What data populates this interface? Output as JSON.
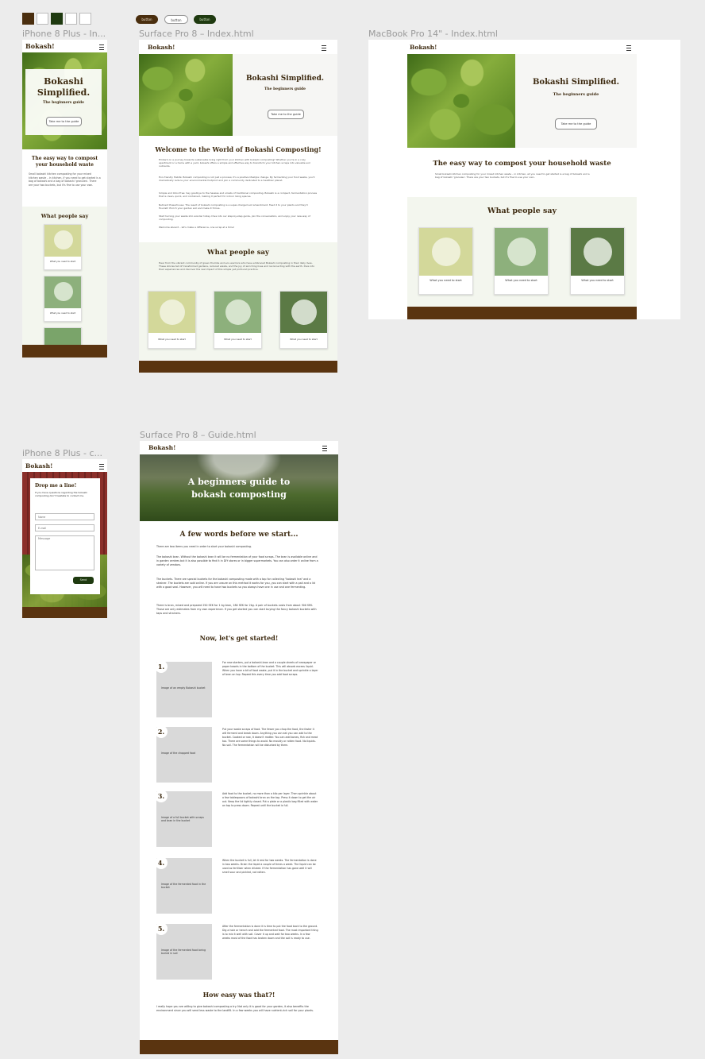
{
  "palette": {
    "colors": [
      "#4a2e0e",
      "#ffffff",
      "#1f3a10",
      "#ffffff",
      "#ffffff"
    ],
    "buttons": [
      "button",
      "button",
      "button"
    ]
  },
  "frames": {
    "iphone_index": {
      "label": "iPhone 8 Plus - In...",
      "brand": "Bokash!",
      "hero_title": "Bokashi Simplified.",
      "hero_sub": "The beginners guide",
      "hero_btn": "Take me to the guide",
      "intro_title": "The easy way to compost your household waste",
      "intro_text": "Small bokashi kitchen composting for your mixed kitchen waste – in kitchen, if you need to get started is a bag of bokashi and a bag of bokashi 'granules'. There are your two buckets, but it's fine to use your own.",
      "testimonials_title": "What people say",
      "card_caption": "What you need to start"
    },
    "surface_index": {
      "label": "Surface Pro 8 – Index.html",
      "brand": "Bokash!",
      "hero_title": "Bokashi Simplified.",
      "hero_sub": "The beginners guide",
      "hero_btn": "Take me to the guide",
      "welcome_title": "Welcome to the World of Bokashi Composting!",
      "paragraphs": [
        "Embark on a journey towards sustainable living right from your kitchen with bokashi composting! Whether you're in a cozy apartment or a home with a yard, bokashi offers a simple and effective way to transform your kitchen scraps into valuable soil nutrients.",
        "Eco-friendly Habits: Bokashi composting is not just a process; it's a positive lifestyle change. By fermenting your food waste, you'll dramatically reduce your environmental footprint and join a community dedicated to a healthier planet.",
        "Simple and Odor-Free: Say goodbye to the hassles and smells of traditional composting. Bokashi is a compact, fermentation process that is clean, quick, and contained, making it perfect for indoor living spaces.",
        "Nutrient Powerhouse: The result of bokashi composting is a super-charged soil amendment. Feed it to your plants and they'll flourish! Enrich your garden soil and make it thrive.",
        "Start turning your waste into wonder today. Dive into our step-by-step guide, join the conversation, and enjoy your new way of composting.",
        "Welcome aboard – let's make a difference, one scrap at a time!"
      ],
      "testimonials_title": "What people say",
      "testimonials_intro": "Hear from the vibrant community of green thumbs and eco-warriors who have embraced Bokashi composting in their daily lives. These stories tell of transformed gardens, reduced waste, and the joy of enriching lives and reconnecting with the earth. Dive into their experiences and discover the real impact of this simple yet profound practice.",
      "card_caption": "What you need to start"
    },
    "macbook_index": {
      "label": "MacBook Pro 14\" - Index.html",
      "brand": "Bokash!",
      "hero_title": "Bokashi Simplified.",
      "hero_sub": "The beginners guide",
      "hero_btn": "Take me to the guide",
      "intro_title": "The easy way to compost your household waste",
      "intro_text": "Small bokashi kitchen composting for your mixed kitchen waste – in kitchen, all you need to get started is a bag of bokashi and a bag of bokashi 'granules'. There are your two buckets, but it's fine to use your own.",
      "testimonials_title": "What people say",
      "card_caption": "What you need to start"
    },
    "iphone_contact": {
      "label": "iPhone 8 Plus - c...",
      "brand": "Bokash!",
      "title": "Drop me a line!",
      "text": "If you have questions regarding the bokashi composting don't hesitate to contact me.",
      "name_placeholder": "Name",
      "email_placeholder": "E-mail",
      "message_placeholder": "Message",
      "send": "Send"
    },
    "surface_guide": {
      "label": "Surface Pro 8 – Guide.html",
      "brand": "Bokash!",
      "hero_title": "A beginners guide to bokash composting",
      "before_title": "A few words before we start...",
      "before_paragraphs": [
        "There are two items you need in order to start your bokashi composting.",
        "The bokashi bran. Without the bokashi bran it will be no fermentation of your food scraps. The bran is available online and in garden centres but it is also possible to find it in DIY stores or in bigger supermarkets. You can also order it online from a variety of vendors.",
        "The buckets. There are special buckets for the bokashi composting made with a tap for collecting \"bokashi tea\" and a strainer. The buckets are sold online. If you are unsure on this method it works for you, you can start with a pail and a lid with a good seal. However, you will need to have two buckets so you always have one in use and one fermenting.",
        "There is bran, mixed and prepared 250 SEK for 1 kg bran, 180 SEK for 2kg. A pair of buckets costs from about 300 SEK. Those are only estimates from my own experience. If you get started you can start buying the fancy bokashi buckets with taps and strainers."
      ],
      "start_title": "Now, let's get started!",
      "steps": [
        {
          "num": "1.",
          "img": "Image of an empty Bokashi bucket",
          "text": "For new starters, put a bokashi-bran and a couple sheets of newspaper or paper towels in the bottom of the bucket. This will absorb excess liquid. When you have a bit of food waste, put it in the bucket and sprinkle a layer of bran on top. Repeat this every time you add food scraps."
        },
        {
          "num": "2.",
          "img": "Image of the chopped food",
          "text": "Put your waste scraps of food. The fewer you chop the food, the faster it will ferment and break down. Anything you can eat you can add to the bucket. Cooked or raw, it doesn't matter. You can add bones, fish and meat too. There are some things to avoid. No mouldy or rotten food. No liquids. No soil. The fermentation will be disturbed by them."
        },
        {
          "num": "3.",
          "img": "Image of a full bucket with scraps and bran in the bucket",
          "text": "Add food to the bucket, no more than a kilo per layer. Then sprinkle about a few tablespoons of bokashi bran on the top. Press it down to get the air out. Keep the lid tightly closed. Put a plate or a plastic bag filled with water on top to press down. Repeat until the bucket is full."
        },
        {
          "num": "4.",
          "img": "Image of the fermented food in the bucket",
          "text": "When the bucket is full, let it rest for two weeks. The fermentation is done in two weeks. Drain the liquid a couple of times a week. The liquid can be used as fertilizer when diluted. If the fermentation has gone well it will smell sour and pickled, not rotten."
        },
        {
          "num": "5.",
          "img": "Image of the fermented food being buried in soil",
          "text": "After the fermentation is done it is time to put the food back to the ground. Dig a hole or trench and add the fermented food. The most important thing is to mix it well with soil. Cover it up and wait for two weeks. In a few weeks most of the food has broken down and the soil is ready to use."
        }
      ],
      "end_title": "How easy was that?!",
      "end_text": "I really hope you are willing to give bokashi composting a try. Not only it is good for your garden, it also benefits the environment since you will send less waste to the landfill. In a few weeks you will have nutrient-rich soil for your plants."
    }
  }
}
